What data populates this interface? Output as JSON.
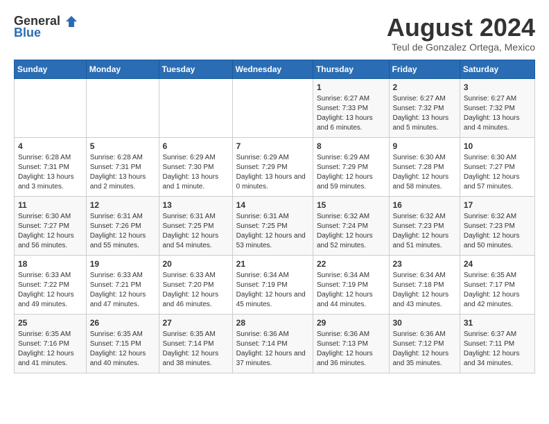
{
  "logo": {
    "general": "General",
    "blue": "Blue"
  },
  "title": "August 2024",
  "subtitle": "Teul de Gonzalez Ortega, Mexico",
  "days_of_week": [
    "Sunday",
    "Monday",
    "Tuesday",
    "Wednesday",
    "Thursday",
    "Friday",
    "Saturday"
  ],
  "weeks": [
    [
      {
        "day": "",
        "info": ""
      },
      {
        "day": "",
        "info": ""
      },
      {
        "day": "",
        "info": ""
      },
      {
        "day": "",
        "info": ""
      },
      {
        "day": "1",
        "info": "Sunrise: 6:27 AM\nSunset: 7:33 PM\nDaylight: 13 hours and 6 minutes."
      },
      {
        "day": "2",
        "info": "Sunrise: 6:27 AM\nSunset: 7:32 PM\nDaylight: 13 hours and 5 minutes."
      },
      {
        "day": "3",
        "info": "Sunrise: 6:27 AM\nSunset: 7:32 PM\nDaylight: 13 hours and 4 minutes."
      }
    ],
    [
      {
        "day": "4",
        "info": "Sunrise: 6:28 AM\nSunset: 7:31 PM\nDaylight: 13 hours and 3 minutes."
      },
      {
        "day": "5",
        "info": "Sunrise: 6:28 AM\nSunset: 7:31 PM\nDaylight: 13 hours and 2 minutes."
      },
      {
        "day": "6",
        "info": "Sunrise: 6:29 AM\nSunset: 7:30 PM\nDaylight: 13 hours and 1 minute."
      },
      {
        "day": "7",
        "info": "Sunrise: 6:29 AM\nSunset: 7:29 PM\nDaylight: 13 hours and 0 minutes."
      },
      {
        "day": "8",
        "info": "Sunrise: 6:29 AM\nSunset: 7:29 PM\nDaylight: 12 hours and 59 minutes."
      },
      {
        "day": "9",
        "info": "Sunrise: 6:30 AM\nSunset: 7:28 PM\nDaylight: 12 hours and 58 minutes."
      },
      {
        "day": "10",
        "info": "Sunrise: 6:30 AM\nSunset: 7:27 PM\nDaylight: 12 hours and 57 minutes."
      }
    ],
    [
      {
        "day": "11",
        "info": "Sunrise: 6:30 AM\nSunset: 7:27 PM\nDaylight: 12 hours and 56 minutes."
      },
      {
        "day": "12",
        "info": "Sunrise: 6:31 AM\nSunset: 7:26 PM\nDaylight: 12 hours and 55 minutes."
      },
      {
        "day": "13",
        "info": "Sunrise: 6:31 AM\nSunset: 7:25 PM\nDaylight: 12 hours and 54 minutes."
      },
      {
        "day": "14",
        "info": "Sunrise: 6:31 AM\nSunset: 7:25 PM\nDaylight: 12 hours and 53 minutes."
      },
      {
        "day": "15",
        "info": "Sunrise: 6:32 AM\nSunset: 7:24 PM\nDaylight: 12 hours and 52 minutes."
      },
      {
        "day": "16",
        "info": "Sunrise: 6:32 AM\nSunset: 7:23 PM\nDaylight: 12 hours and 51 minutes."
      },
      {
        "day": "17",
        "info": "Sunrise: 6:32 AM\nSunset: 7:23 PM\nDaylight: 12 hours and 50 minutes."
      }
    ],
    [
      {
        "day": "18",
        "info": "Sunrise: 6:33 AM\nSunset: 7:22 PM\nDaylight: 12 hours and 49 minutes."
      },
      {
        "day": "19",
        "info": "Sunrise: 6:33 AM\nSunset: 7:21 PM\nDaylight: 12 hours and 47 minutes."
      },
      {
        "day": "20",
        "info": "Sunrise: 6:33 AM\nSunset: 7:20 PM\nDaylight: 12 hours and 46 minutes."
      },
      {
        "day": "21",
        "info": "Sunrise: 6:34 AM\nSunset: 7:19 PM\nDaylight: 12 hours and 45 minutes."
      },
      {
        "day": "22",
        "info": "Sunrise: 6:34 AM\nSunset: 7:19 PM\nDaylight: 12 hours and 44 minutes."
      },
      {
        "day": "23",
        "info": "Sunrise: 6:34 AM\nSunset: 7:18 PM\nDaylight: 12 hours and 43 minutes."
      },
      {
        "day": "24",
        "info": "Sunrise: 6:35 AM\nSunset: 7:17 PM\nDaylight: 12 hours and 42 minutes."
      }
    ],
    [
      {
        "day": "25",
        "info": "Sunrise: 6:35 AM\nSunset: 7:16 PM\nDaylight: 12 hours and 41 minutes."
      },
      {
        "day": "26",
        "info": "Sunrise: 6:35 AM\nSunset: 7:15 PM\nDaylight: 12 hours and 40 minutes."
      },
      {
        "day": "27",
        "info": "Sunrise: 6:35 AM\nSunset: 7:14 PM\nDaylight: 12 hours and 38 minutes."
      },
      {
        "day": "28",
        "info": "Sunrise: 6:36 AM\nSunset: 7:14 PM\nDaylight: 12 hours and 37 minutes."
      },
      {
        "day": "29",
        "info": "Sunrise: 6:36 AM\nSunset: 7:13 PM\nDaylight: 12 hours and 36 minutes."
      },
      {
        "day": "30",
        "info": "Sunrise: 6:36 AM\nSunset: 7:12 PM\nDaylight: 12 hours and 35 minutes."
      },
      {
        "day": "31",
        "info": "Sunrise: 6:37 AM\nSunset: 7:11 PM\nDaylight: 12 hours and 34 minutes."
      }
    ]
  ]
}
